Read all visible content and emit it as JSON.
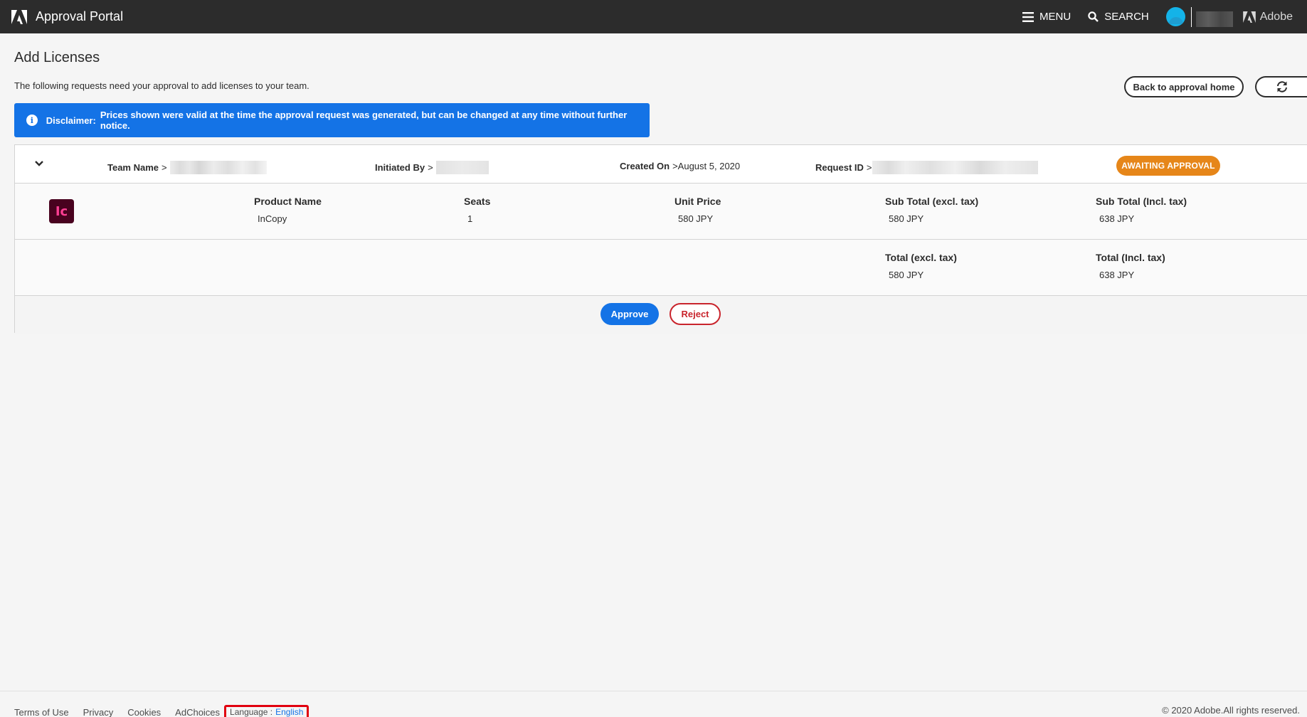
{
  "header": {
    "app_title": "Approval Portal",
    "menu_label": "MENU",
    "search_label": "SEARCH",
    "adobe_label": "Adobe",
    "logo_icon": "adobe-logo-icon"
  },
  "page": {
    "title": "Add Licenses",
    "subtitle": "The following requests need your approval to add licenses to your team.",
    "back_button": "Back to approval home",
    "refresh_icon": "refresh-icon"
  },
  "disclaimer": {
    "label": "Disclaimer:",
    "text": "Prices shown were valid at the time the approval request was generated, but can be changed at any time without further notice."
  },
  "request": {
    "team_name_label": "Team Name",
    "initiated_by_label": "Initiated By",
    "created_on_label": "Created On",
    "created_on_value": "August 5, 2020",
    "request_id_label": "Request ID",
    "separator": ">",
    "status": "AWAITING APPROVAL",
    "status_color": "#e68619",
    "product": {
      "icon_text": "Ic",
      "columns": [
        {
          "label": "Product Name",
          "value": "InCopy"
        },
        {
          "label": "Seats",
          "value": "1"
        },
        {
          "label": "Unit Price",
          "value": "580 JPY"
        },
        {
          "label": "Sub Total (excl. tax)",
          "value": "580 JPY"
        },
        {
          "label": "Sub Total (Incl. tax)",
          "value": "638 JPY"
        }
      ]
    },
    "totals": [
      {
        "label": "Total (excl. tax)",
        "value": "580 JPY"
      },
      {
        "label": "Total (Incl. tax)",
        "value": "638 JPY"
      }
    ],
    "approve_label": "Approve",
    "reject_label": "Reject"
  },
  "footer": {
    "links": [
      "Terms of Use",
      "Privacy",
      "Cookies",
      "AdChoices"
    ],
    "language_label": "Language :",
    "language_value": "English",
    "copyright": "© 2020 Adobe.All rights reserved."
  },
  "colors": {
    "accent": "#1473e6",
    "topbar": "#2c2c2c",
    "reject": "#c9252d",
    "highlight": "#e1000f"
  }
}
